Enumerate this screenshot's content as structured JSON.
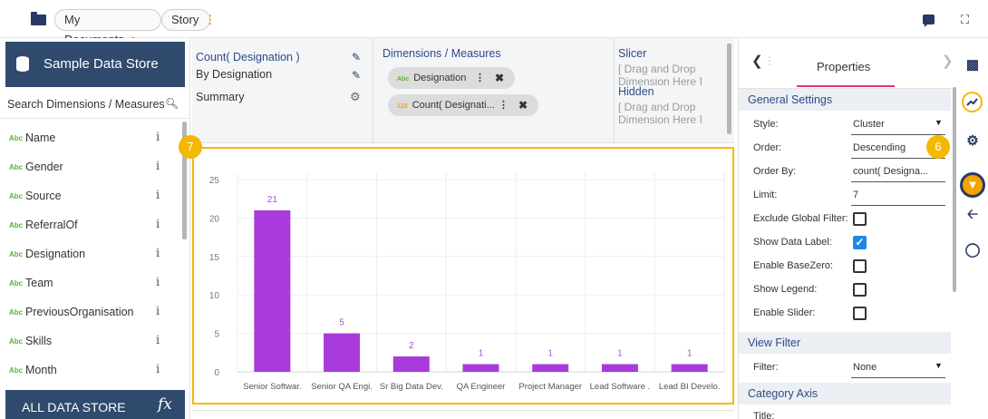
{
  "topbar": {
    "crumbs": [
      "My Documents",
      "Story"
    ],
    "crumb_chevron": ">",
    "crumb_menu": "⋮",
    "expand_glyph": "⛶"
  },
  "sidebar": {
    "title": "Sample Data Store",
    "search_label": "Search Dimensions / Measures",
    "type_tag": "Abc",
    "info_glyph": "i",
    "fields": [
      "Name",
      "Gender",
      "Source",
      "ReferralOf",
      "Designation",
      "Team",
      "PreviousOrganisation",
      "Skills",
      "Month"
    ],
    "footer_label": "ALL DATA STORE",
    "footer_icon": "fx"
  },
  "config": {
    "measure_label": "Count( Designation )",
    "by_label": "By Designation",
    "summary_label": "Summary",
    "dimensions_header": "Dimensions / Measures",
    "pill_designation": "Designation",
    "pill_count": "Count( Designati...",
    "pill_tag_abc": "Abc",
    "pill_tag_num": "123",
    "slicer_header": "Slicer",
    "drop_line1": "[ Drag and Drop",
    "drop_line2": "Dimension Here ]",
    "hidden_header": "Hidden"
  },
  "badges": {
    "chart": "7",
    "filter": "6"
  },
  "chart_data": {
    "type": "bar",
    "categories": [
      "Senior Softwar.",
      "Senior QA Engi.",
      "Sr Big Data Dev.",
      "QA Engineer",
      "Project Manager",
      "Lead Software .",
      "Lead BI Develo."
    ],
    "values": [
      21,
      5,
      2,
      1,
      1,
      1,
      1
    ],
    "ylim": [
      0,
      25
    ],
    "yticks": [
      0,
      5,
      10,
      15,
      20,
      25
    ],
    "grid": true,
    "data_labels": true,
    "bar_color": "#a93adb",
    "label_color": "#b04ae0"
  },
  "properties": {
    "title": "Properties",
    "general_header": "General Settings",
    "style_label": "Style:",
    "style_value": "Cluster",
    "order_label": "Order:",
    "order_value": "Descending",
    "orderby_label": "Order By:",
    "orderby_value": "count( Designa...",
    "limit_label": "Limit:",
    "limit_value": "7",
    "exclude_label": "Exclude Global Filter:",
    "datalabel_label": "Show Data Label:",
    "basezero_label": "Enable BaseZero:",
    "legend_label": "Show Legend:",
    "slider_label": "Enable Slider:",
    "viewfilter_header": "View Filter",
    "filter_label": "Filter:",
    "filter_value": "None",
    "category_header": "Category Axis",
    "title_label": "Title:",
    "show_data_label": true
  },
  "colors": {
    "navy": "#2f4a6d",
    "accent": "#f5b800",
    "link": "#2f4a87",
    "pink": "#e7317c"
  }
}
